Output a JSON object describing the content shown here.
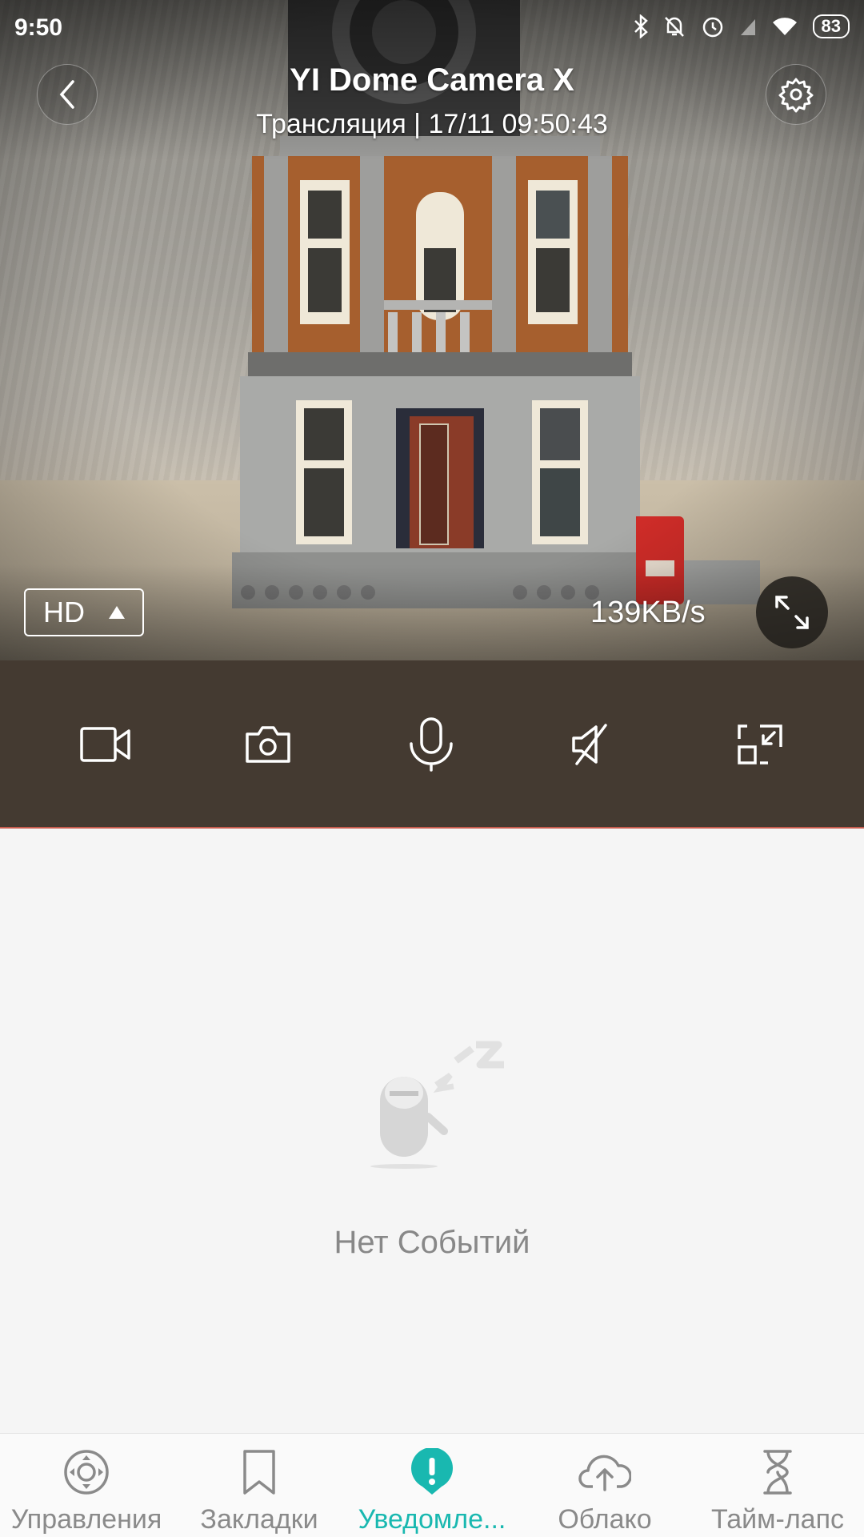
{
  "status_bar": {
    "time": "9:50",
    "battery": "83"
  },
  "header": {
    "title": "YI Dome Camera X",
    "subtitle": "Трансляция | 17/11 09:50:43"
  },
  "video": {
    "quality": "HD",
    "bitrate": "139KB/s"
  },
  "controls": [
    {
      "name": "record-video",
      "icon": "video-camera-icon"
    },
    {
      "name": "snapshot",
      "icon": "camera-icon"
    },
    {
      "name": "microphone",
      "icon": "microphone-icon"
    },
    {
      "name": "mute",
      "icon": "speaker-muted-icon"
    },
    {
      "name": "pip",
      "icon": "minimize-window-icon"
    }
  ],
  "events": {
    "empty_label": "Нет Событий"
  },
  "bottom_nav": {
    "items": [
      {
        "label": "Управления",
        "icon": "joystick-icon",
        "active": false
      },
      {
        "label": "Закладки",
        "icon": "bookmark-icon",
        "active": false
      },
      {
        "label": "Уведомле...",
        "icon": "alert-icon",
        "active": true
      },
      {
        "label": "Облако",
        "icon": "cloud-upload-icon",
        "active": false
      },
      {
        "label": "Тайм-лапс",
        "icon": "hourglass-icon",
        "active": false
      }
    ]
  },
  "colors": {
    "accent": "#19b8b0",
    "control_bar": "#443a31"
  }
}
